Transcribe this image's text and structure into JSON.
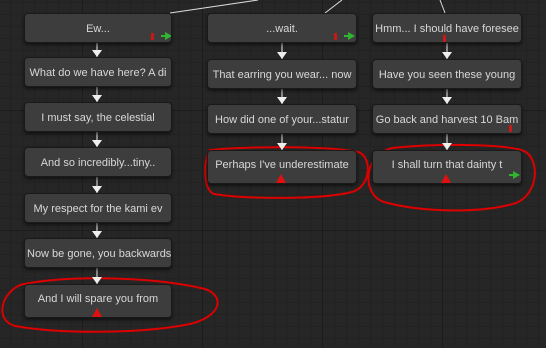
{
  "graph": {
    "columns": [
      {
        "id": "col1",
        "nodes": [
          {
            "label": "Ew..."
          },
          {
            "label": "What do we have here? A di"
          },
          {
            "label": "I must say, the celestial"
          },
          {
            "label": "And so incredibly...tiny.."
          },
          {
            "label": "My respect for the kami ev"
          },
          {
            "label": "Now be gone, you backwards"
          },
          {
            "label": "And I will spare you from"
          }
        ]
      },
      {
        "id": "col2",
        "nodes": [
          {
            "label": "...wait."
          },
          {
            "label": "That earring you wear... now"
          },
          {
            "label": "How did one of your...statur"
          },
          {
            "label": "Perhaps I've underestimate"
          }
        ]
      },
      {
        "id": "col3",
        "nodes": [
          {
            "label": "Hmm... I should have foresee"
          },
          {
            "label": "Have you seen these young"
          },
          {
            "label": "Go back and harvest 10 Bam"
          },
          {
            "label": "I shall turn that dainty t"
          }
        ]
      }
    ]
  },
  "colors": {
    "background": "#262626",
    "node_fill": "#3d3d3d",
    "node_text": "#d8d8d8",
    "connector": "#efefef",
    "annotation": "#dd0000",
    "port_green": "#2fb52f"
  }
}
